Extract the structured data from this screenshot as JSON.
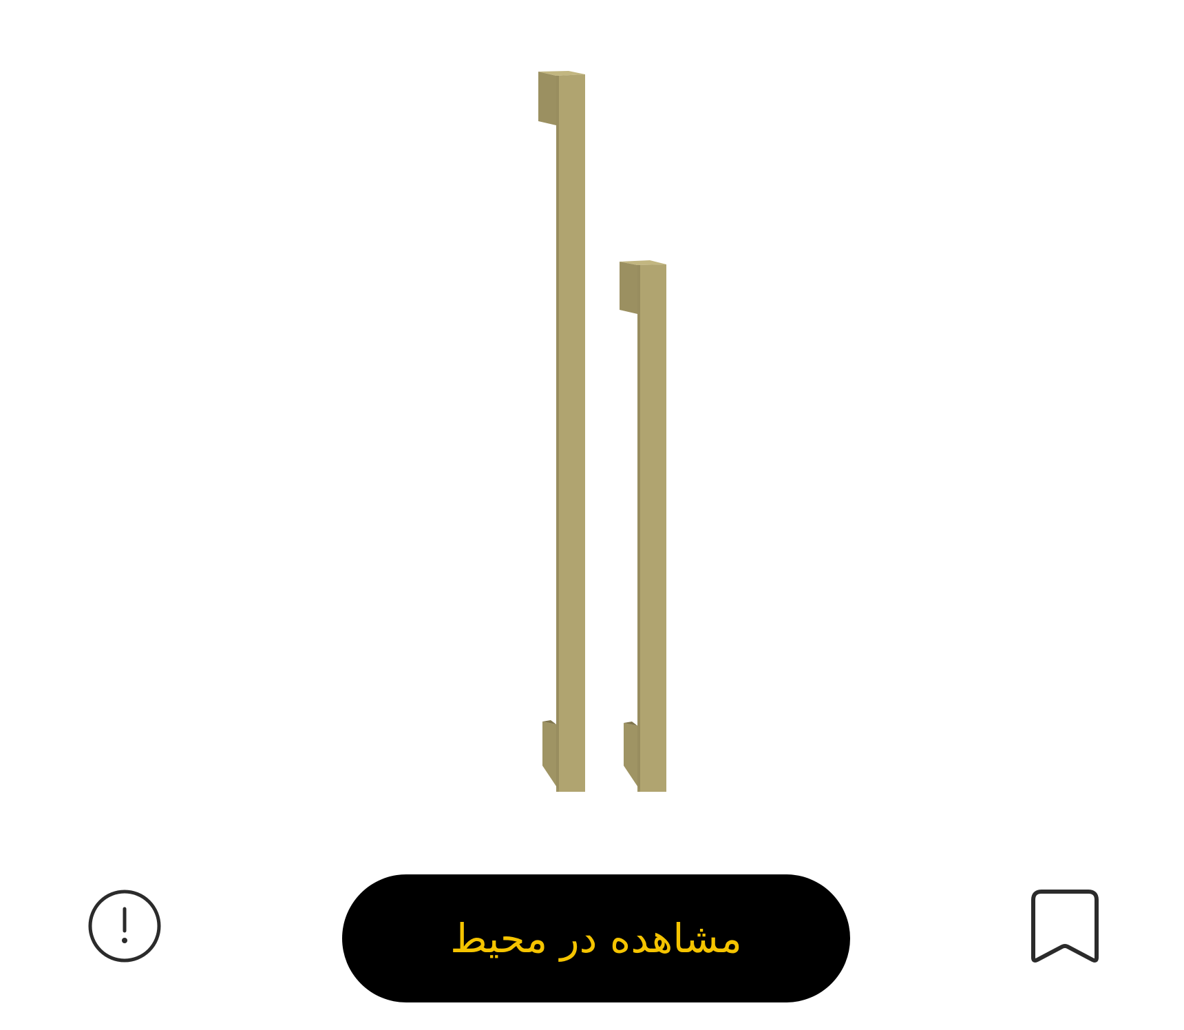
{
  "product": {
    "image_icon": "door-pull-handles-image",
    "color": "#ab9f6b"
  },
  "actions": {
    "view_in_room_label": "مشاهده در محیط",
    "accent_color": "#f5c400",
    "report_icon": "exclamation-circle-icon",
    "bookmark_icon": "bookmark-icon"
  }
}
